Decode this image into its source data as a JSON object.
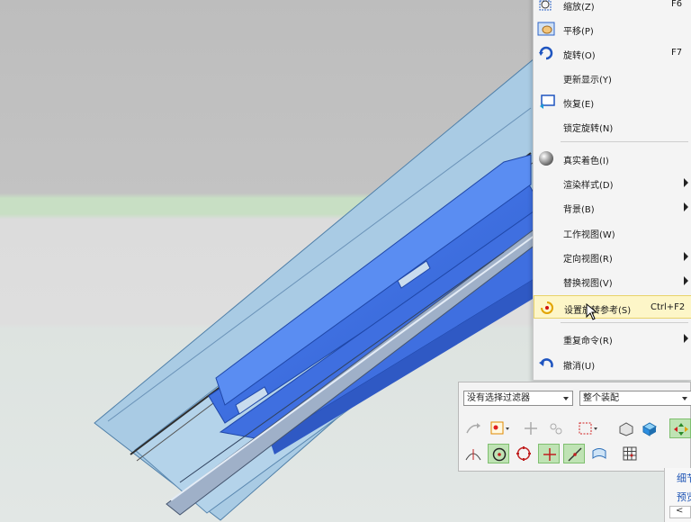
{
  "menu": {
    "items": [
      {
        "label": "缩放(Z)",
        "shortcut": "F6",
        "icon": "zoom-icon",
        "submenu": false
      },
      {
        "label": "平移(P)",
        "shortcut": "",
        "icon": "pan-hand-icon",
        "submenu": false
      },
      {
        "label": "旋转(O)",
        "shortcut": "F7",
        "icon": "rotate-icon",
        "submenu": false
      },
      {
        "label": "更新显示(Y)",
        "shortcut": "",
        "icon": "",
        "submenu": false
      },
      {
        "label": "恢复(E)",
        "shortcut": "",
        "icon": "restore-icon",
        "submenu": false
      },
      {
        "label": "锁定旋转(N)",
        "shortcut": "",
        "icon": "",
        "submenu": false
      },
      {
        "label": "真实着色(I)",
        "shortcut": "",
        "icon": "sphere-icon",
        "submenu": false
      },
      {
        "label": "渲染样式(D)",
        "shortcut": "",
        "icon": "",
        "submenu": true
      },
      {
        "label": "背景(B)",
        "shortcut": "",
        "icon": "",
        "submenu": true
      },
      {
        "label": "工作视图(W)",
        "shortcut": "",
        "icon": "",
        "submenu": false
      },
      {
        "label": "定向视图(R)",
        "shortcut": "",
        "icon": "",
        "submenu": true
      },
      {
        "label": "替换视图(V)",
        "shortcut": "",
        "icon": "",
        "submenu": true
      },
      {
        "label": "设置旋转参考(S)",
        "shortcut": "Ctrl+F2",
        "icon": "rotation-reference-icon",
        "submenu": false,
        "highlighted": true
      },
      {
        "label": "重复命令(R)",
        "shortcut": "",
        "icon": "",
        "submenu": true
      },
      {
        "label": "撤消(U)",
        "shortcut": "",
        "icon": "undo-icon",
        "submenu": false
      }
    ]
  },
  "selection_bar": {
    "filter": "没有选择过滤器",
    "scope": "整个装配"
  },
  "side_panel": {
    "line1": "细节",
    "line2": "预览",
    "scroll_glyph": "<"
  },
  "colors": {
    "background_top": "#c0c0c0",
    "background_band": "#c8dfc4",
    "background_bottom": "#dde3e0",
    "sheet_light_blue": "#a9cbe4",
    "part_blue": "#3d6fe0",
    "menu_highlight": "#fdf6c8"
  }
}
